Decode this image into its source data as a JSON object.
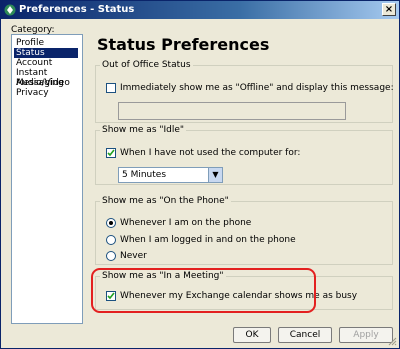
{
  "window": {
    "title": "Preferences - Status"
  },
  "sidebar": {
    "label": "Category:",
    "items": [
      "Profile",
      "Status",
      "Account",
      "Instant Messaging",
      "Audio/Video",
      "Privacy"
    ],
    "selected": "Status"
  },
  "main": {
    "title": "Status Preferences",
    "out_of_office": {
      "group_title": "Out of Office Status",
      "checkbox_label": "Immediately show me as \"Offline\" and display this message:",
      "checked": false,
      "message_value": ""
    },
    "idle": {
      "group_title": "Show me as \"Idle\"",
      "checkbox_label": "When I have not used the computer for:",
      "checked": true,
      "duration_value": "5 Minutes"
    },
    "on_phone": {
      "group_title": "Show me as \"On the Phone\"",
      "options": [
        "Whenever I am on the phone",
        "When I am logged in and on the phone",
        "Never"
      ],
      "selected": "Whenever I am on the phone"
    },
    "in_meeting": {
      "group_title": "Show me as \"In a Meeting\"",
      "checkbox_label": "Whenever my Exchange calendar shows me as busy",
      "checked": true
    }
  },
  "buttons": {
    "ok": "OK",
    "cancel": "Cancel",
    "apply": "Apply"
  },
  "colors": {
    "highlight": "#e32020",
    "selection": "#0a246a"
  }
}
